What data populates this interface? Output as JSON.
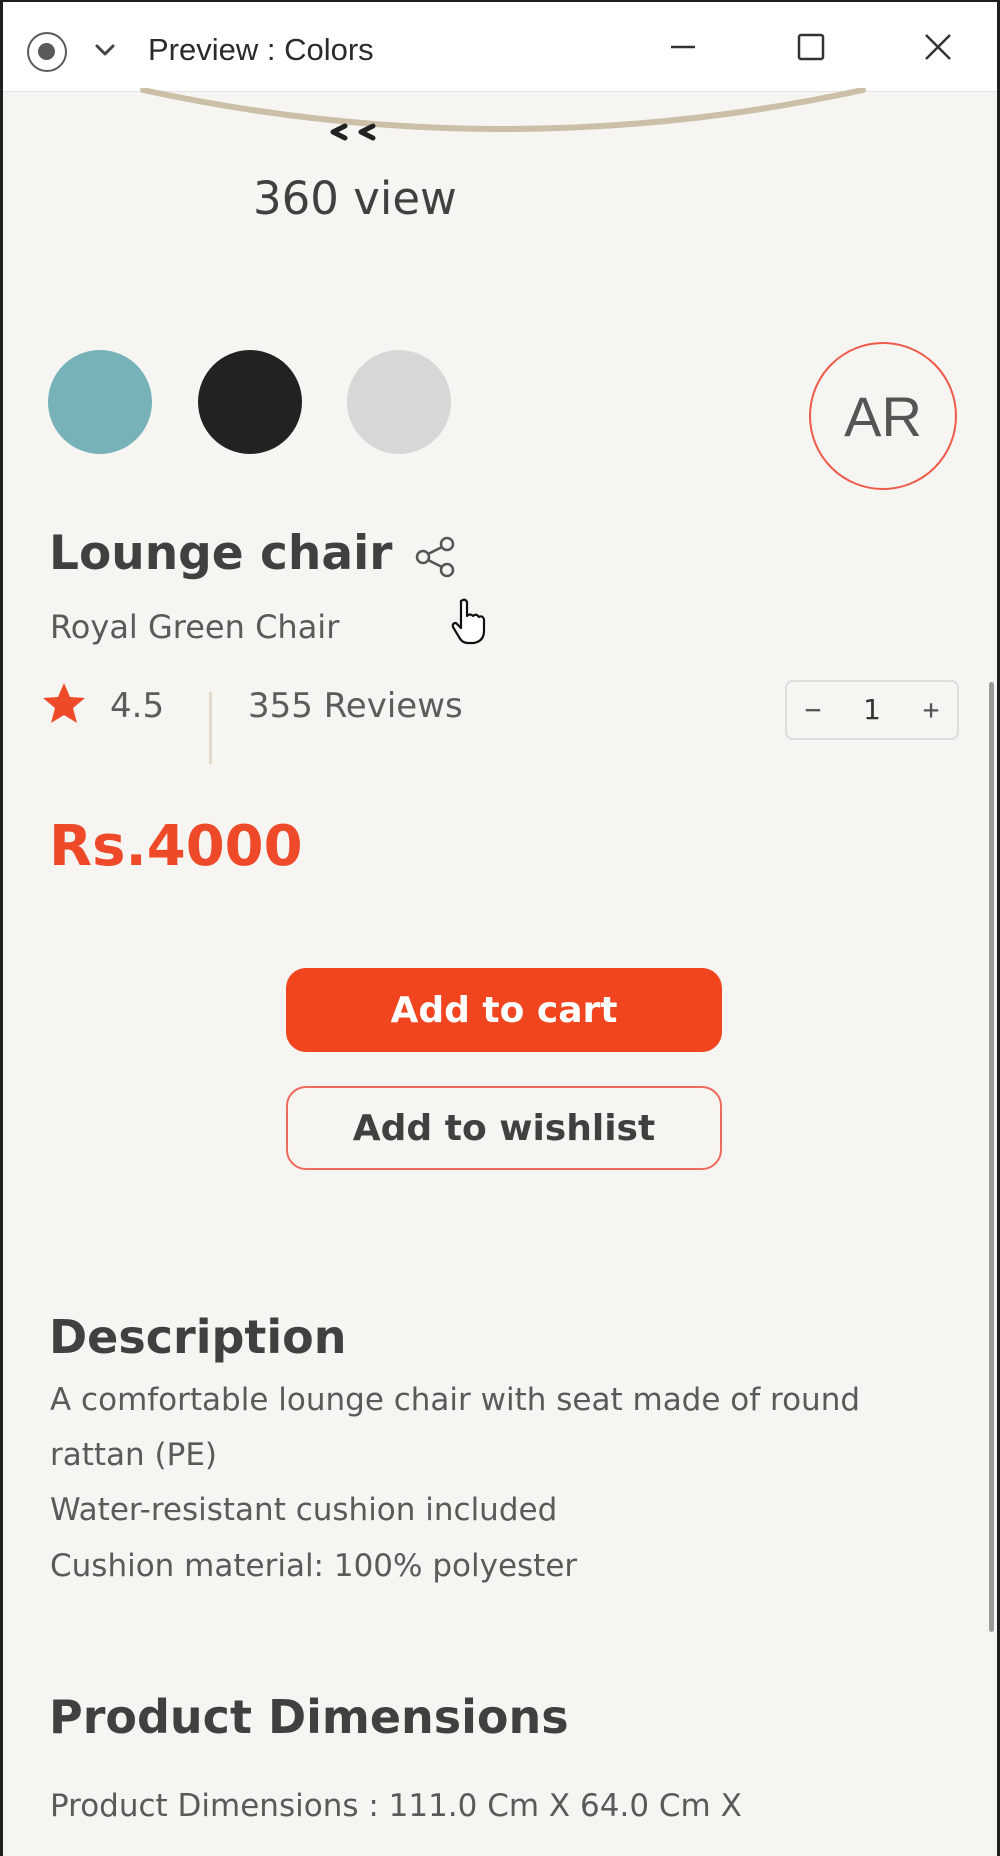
{
  "window": {
    "title": "Preview : Colors"
  },
  "viewer": {
    "label": "360 view"
  },
  "colors": {
    "swatches": [
      "#76b2b8",
      "#222222",
      "#d7d7d7"
    ],
    "accent": "#f0451f"
  },
  "ar_button": {
    "label": "AR"
  },
  "product": {
    "title": "Lounge chair",
    "subtitle": "Royal Green Chair",
    "rating": "4.5",
    "reviews": "355 Reviews",
    "price": "Rs.4000"
  },
  "quantity": {
    "minus": "−",
    "value": "1",
    "plus": "+"
  },
  "actions": {
    "add_to_cart": "Add to cart",
    "add_to_wishlist": "Add to wishlist"
  },
  "description": {
    "heading": "Description",
    "lines": [
      "A comfortable lounge chair with seat made of round",
      "rattan (PE)",
      "Water-resistant cushion included",
      "Cushion material: 100% polyester"
    ]
  },
  "dimensions": {
    "heading": "Product Dimensions",
    "text": "Product Dimensions : 111.0 Cm X 64.0 Cm X"
  }
}
